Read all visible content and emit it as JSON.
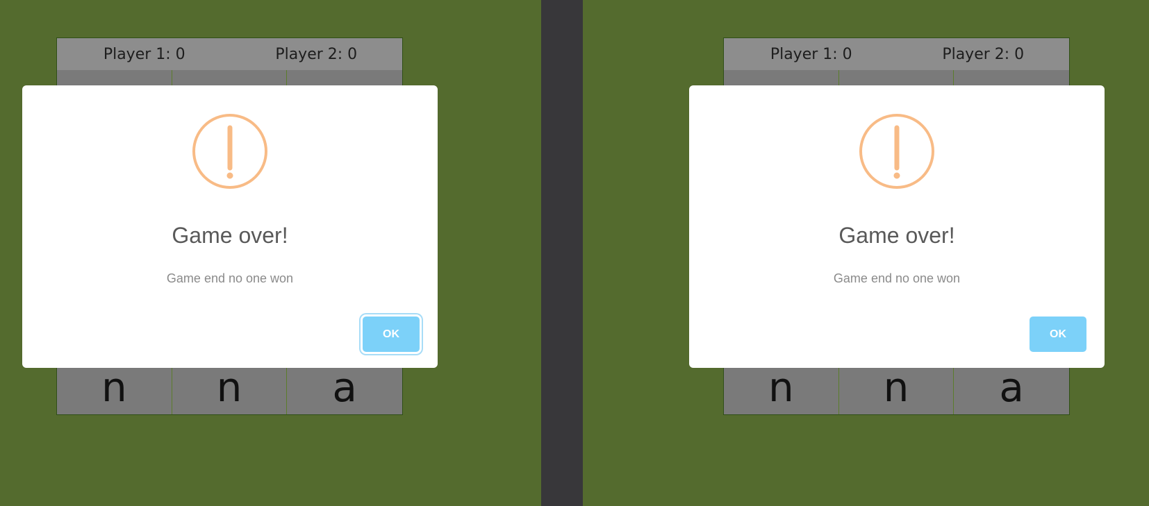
{
  "colors": {
    "background": "#546b2e",
    "divider": "#38373a",
    "board": "#7a7a7a",
    "scorebar": "#8d8d8d",
    "warning_icon": "#f8bb86",
    "ok_button": "#7cd1f9"
  },
  "left": {
    "scoreboard": {
      "player1": "Player 1: 0",
      "player2": "Player 2: 0"
    },
    "cells": [
      "",
      "",
      "",
      "",
      "",
      "",
      "n",
      "n",
      "a"
    ],
    "modal": {
      "icon": "warning-icon",
      "title": "Game over!",
      "text": "Game end no one won",
      "button": "OK"
    }
  },
  "right": {
    "scoreboard": {
      "player1": "Player 1: 0",
      "player2": "Player 2: 0"
    },
    "cells": [
      "",
      "",
      "",
      "",
      "",
      "",
      "n",
      "n",
      "a"
    ],
    "modal": {
      "icon": "warning-icon",
      "title": "Game over!",
      "text": "Game end no one won",
      "button": "OK"
    }
  }
}
